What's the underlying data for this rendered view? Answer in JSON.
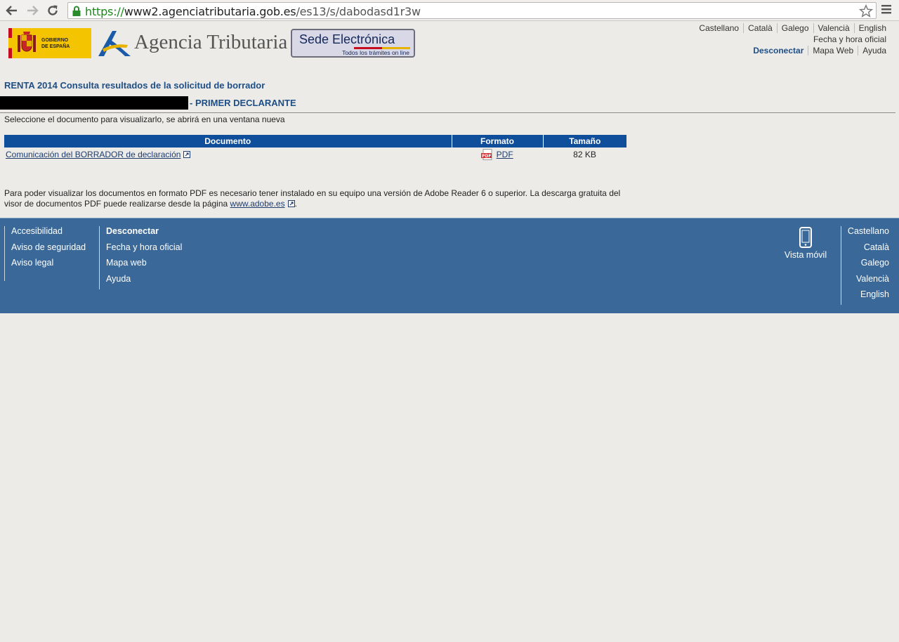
{
  "browser": {
    "url_scheme": "https://",
    "url_host": "www2.agenciatributaria.gob.es",
    "url_path": "/es13/s/dabodasd1r3w"
  },
  "header": {
    "gobierno_line1": "GOBIERNO",
    "gobierno_line2": "DE ESPAÑA",
    "agency_name": "Agencia Tributaria",
    "sede_title": "Sede Electrónica",
    "sede_subtitle": "Todos los trámites on line"
  },
  "top_links": {
    "languages": [
      "Castellano",
      "Català",
      "Galego",
      "Valencià",
      "English"
    ],
    "fecha_hora": "Fecha y hora oficial",
    "desconectar": "Desconectar",
    "mapa_web": "Mapa Web",
    "ayuda": "Ayuda"
  },
  "content": {
    "title": "RENTA 2014 Consulta resultados de la solicitud de borrador",
    "declarante": "- PRIMER DECLARANTE",
    "instructions": "Seleccione el documento para visualizarlo, se abrirá en una ventana nueva",
    "table": {
      "headers": [
        "Documento",
        "Formato",
        "Tamaño"
      ],
      "rows": [
        {
          "document": "Comunicación del BORRADOR de declaración",
          "format": "PDF",
          "size": "82 KB"
        }
      ]
    },
    "note_text": "Para poder visualizar los documentos en formato PDF es necesario tener instalado en su equipo una versión de Adobe Reader 6 o superior. La descarga gratuita del visor de documentos PDF puede realizarse desde la página ",
    "note_link": "www.adobe.es",
    "note_end": "."
  },
  "footer": {
    "col1": [
      "Accesibilidad",
      "Aviso de seguridad",
      "Aviso legal"
    ],
    "col2": [
      "Desconectar",
      "Fecha y hora oficial",
      "Mapa web",
      "Ayuda"
    ],
    "vista_movil": "Vista móvil",
    "languages": [
      "Castellano",
      "Català",
      "Galego",
      "Valencià",
      "English"
    ]
  },
  "colors": {
    "accent_blue": "#1e4e86",
    "table_header": "#0e4e9a",
    "footer_bg": "#3a6898"
  }
}
